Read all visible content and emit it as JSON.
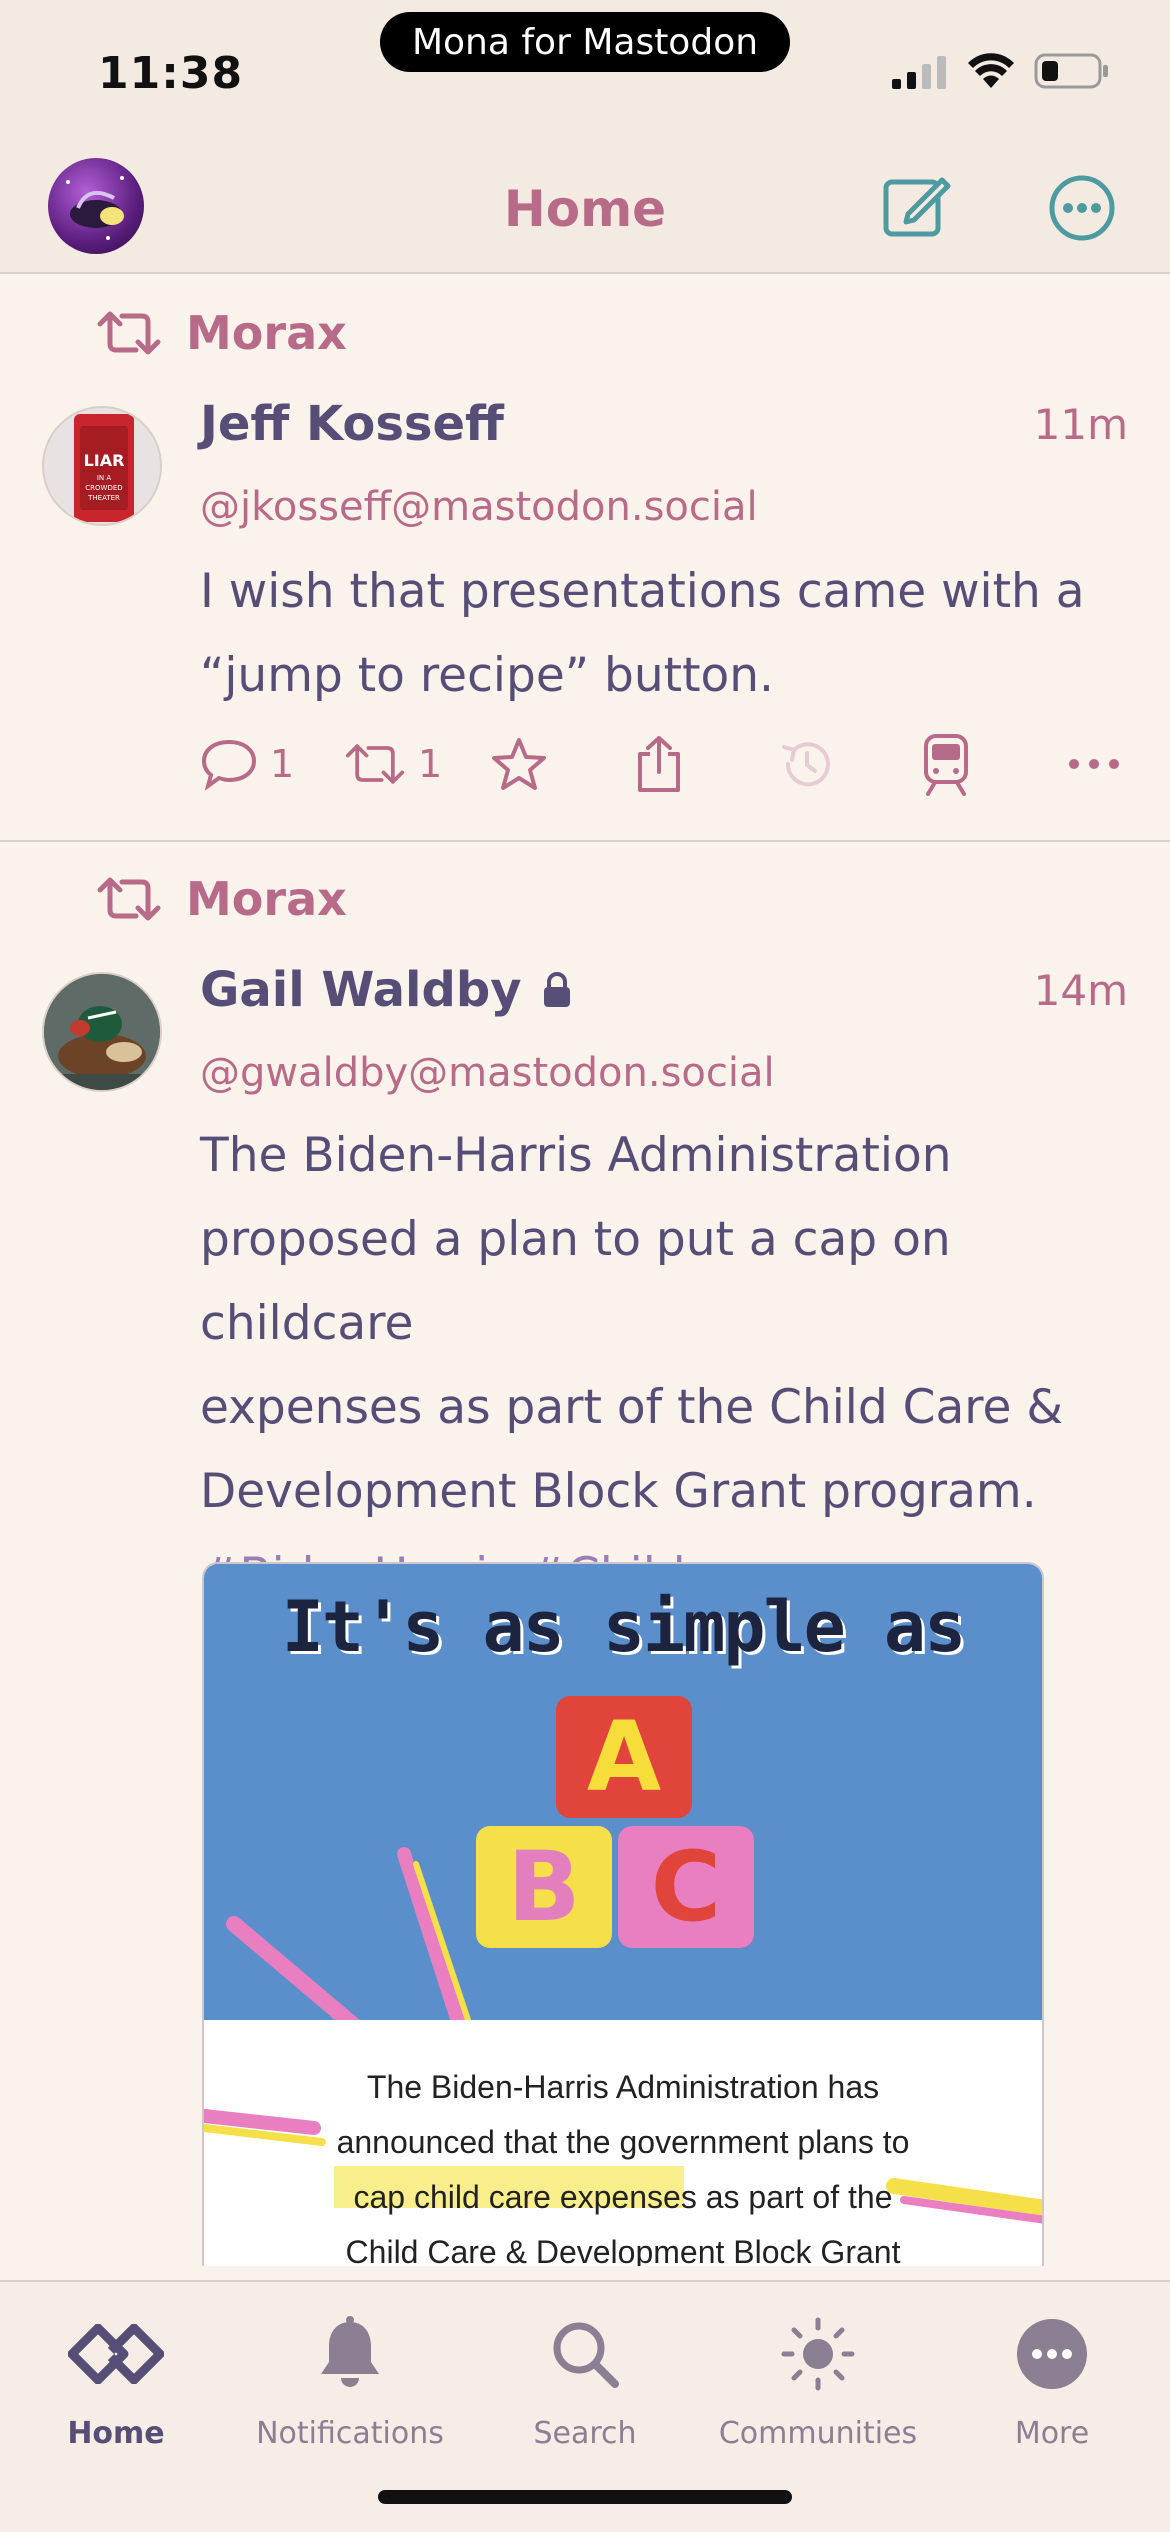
{
  "status_bar": {
    "time": "11:38",
    "island_label": "Mona for Mastodon"
  },
  "nav": {
    "title": "Home",
    "icons": [
      "avatar",
      "compose-icon",
      "more-icon"
    ]
  },
  "posts": [
    {
      "boosted_by": "Morax",
      "author": "Jeff Kosseff",
      "time": "11m",
      "handle": "@jkosseff@mastodon.social",
      "text_lines": [
        "I wish that presentations came with a",
        "“jump to recipe” button."
      ],
      "avatar_label": [
        "LIAR",
        "IN A",
        "CROWDED",
        "THEATER"
      ],
      "replies": "1",
      "boosts": "1"
    },
    {
      "boosted_by": "Morax",
      "author": "Gail Waldby",
      "locked": true,
      "time": "14m",
      "handle": "@gwaldby@mastodon.social",
      "text_lines": [
        "The Biden-Harris Administration",
        "proposed a plan to put a cap on childcare",
        "expenses as part of the Child Care &",
        "Development Block Grant program."
      ],
      "hashtags": "#BidenHarris #Childcare #BidenDelivers",
      "media": {
        "headline": "It's as simple as",
        "blocks": [
          "A",
          "B",
          "C"
        ],
        "caption_lines": [
          "The Biden-Harris Administration has",
          "announced that the government plans to",
          "cap child care expenses as part of the",
          "Child Care & Development Block Grant"
        ]
      }
    }
  ],
  "tabs": [
    {
      "label": "Home",
      "icon": "home-icon",
      "active": true
    },
    {
      "label": "Notifications",
      "icon": "bell-icon",
      "active": false
    },
    {
      "label": "Search",
      "icon": "search-icon",
      "active": false
    },
    {
      "label": "Communities",
      "icon": "sun-icon",
      "active": false
    },
    {
      "label": "More",
      "icon": "more-circle-icon",
      "active": false
    }
  ],
  "colors": {
    "accent": "#b86a89",
    "text": "#574e78",
    "background": "#faf3ec",
    "hashtag": "#9a7db6",
    "media_blue": "#5b8fcb"
  }
}
